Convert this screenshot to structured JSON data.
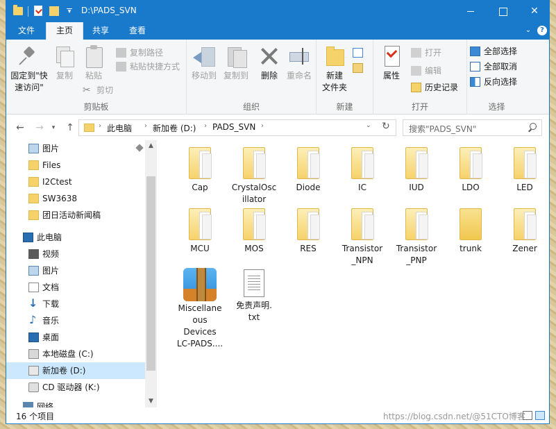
{
  "window": {
    "title": "D:\\PADS_SVN",
    "controls": {
      "minimize": "",
      "maximize": "",
      "close": "✕"
    }
  },
  "ribbon_tabs": [
    {
      "label": "文件"
    },
    {
      "label": "主页",
      "active": true
    },
    {
      "label": "共享"
    },
    {
      "label": "查看"
    }
  ],
  "ribbon": {
    "clipboard": {
      "label": "剪贴板",
      "pin": "固定到\"快\n速访问\"",
      "copy": "复制",
      "paste": "粘贴",
      "copy_path": "复制路径",
      "paste_shortcut": "粘贴快捷方式",
      "cut": "剪切"
    },
    "organize": {
      "label": "组织",
      "move_to": "移动到",
      "copy_to": "复制到",
      "delete": "删除",
      "rename": "重命名"
    },
    "new": {
      "label": "新建",
      "new_folder": "新建\n文件夹"
    },
    "open": {
      "label": "打开",
      "properties": "属性",
      "open": "打开",
      "edit": "编辑",
      "history": "历史记录"
    },
    "select": {
      "label": "选择",
      "select_all": "全部选择",
      "select_none": "全部取消",
      "invert": "反向选择"
    }
  },
  "address": {
    "parts": [
      "此电脑",
      "新加卷 (D:)",
      "PADS_SVN"
    ],
    "search_placeholder": "搜索\"PADS_SVN\""
  },
  "nav_pane": [
    {
      "label": "图片",
      "icon": "pictures",
      "pinned": true
    },
    {
      "label": "Files",
      "icon": "folder"
    },
    {
      "label": "I2Ctest",
      "icon": "folder"
    },
    {
      "label": "SW3638",
      "icon": "folder"
    },
    {
      "label": "团日活动新闻稿",
      "icon": "folder"
    },
    {
      "label": "此电脑",
      "icon": "pc"
    },
    {
      "label": "视频",
      "icon": "video"
    },
    {
      "label": "图片",
      "icon": "pictures"
    },
    {
      "label": "文档",
      "icon": "docs"
    },
    {
      "label": "下载",
      "icon": "down"
    },
    {
      "label": "音乐",
      "icon": "music"
    },
    {
      "label": "桌面",
      "icon": "desktop"
    },
    {
      "label": "本地磁盘 (C:)",
      "icon": "drivec"
    },
    {
      "label": "新加卷 (D:)",
      "icon": "drived",
      "selected": true
    },
    {
      "label": "CD 驱动器 (K:)",
      "icon": "cd"
    },
    {
      "label": "网络",
      "icon": "network"
    }
  ],
  "files": [
    {
      "name": "Cap",
      "type": "folder"
    },
    {
      "name": "CrystalOsc\nillator",
      "type": "folder"
    },
    {
      "name": "Diode",
      "type": "folder"
    },
    {
      "name": "IC",
      "type": "folder"
    },
    {
      "name": "IUD",
      "type": "folder"
    },
    {
      "name": "LDO",
      "type": "folder"
    },
    {
      "name": "LED",
      "type": "folder"
    },
    {
      "name": "MCU",
      "type": "folder"
    },
    {
      "name": "MOS",
      "type": "folder"
    },
    {
      "name": "RES",
      "type": "folder"
    },
    {
      "name": "Transistor\n_NPN",
      "type": "folder"
    },
    {
      "name": "Transistor\n_PNP",
      "type": "folder"
    },
    {
      "name": "trunk",
      "type": "plain-folder"
    },
    {
      "name": "Zener",
      "type": "folder"
    },
    {
      "name": "Miscellane\nous\nDevices\nLC-PADS....",
      "type": "rar"
    },
    {
      "name": "免责声明.\ntxt",
      "type": "txt"
    }
  ],
  "status": {
    "count": "16 个项目",
    "watermark": "https://blog.csdn.net/@51CTO博客"
  },
  "colors": {
    "titlebar": "#1979ca",
    "ribbon_bg": "#f5f6f7",
    "selected": "#cce8ff",
    "folder": "#f6d26b"
  }
}
